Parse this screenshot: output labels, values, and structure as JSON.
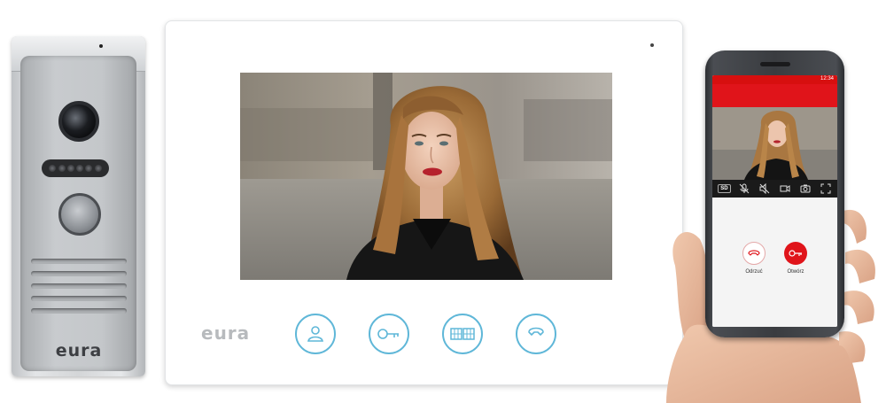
{
  "door_station": {
    "logo": "eura",
    "icons": {
      "camera": "camera-lens-icon",
      "ir_leds": "ir-led-icon",
      "call_button": "call-button-icon",
      "speaker": "speaker-grille-icon"
    },
    "ir_led_count": 6,
    "grille_slots": 5
  },
  "monitor": {
    "logo": "eura",
    "screen_image": "woman-portrait-photo",
    "buttons": [
      {
        "name": "monitor-button",
        "icon": "person-icon"
      },
      {
        "name": "unlock-button",
        "icon": "key-icon"
      },
      {
        "name": "gate-button",
        "icon": "gate-icon"
      },
      {
        "name": "handset-button",
        "icon": "handset-icon"
      }
    ],
    "accent_color": "#5fb7d8"
  },
  "phone": {
    "brand_color": "#e0141a",
    "status_text": "12:34",
    "toolbar": {
      "sd_label": "SD",
      "icons": [
        "mic-muted-icon",
        "speaker-muted-icon",
        "record-icon",
        "snapshot-icon",
        "fullscreen-icon"
      ]
    },
    "decline_label": "Odrzuć",
    "open_label": "Otwórz",
    "icons": {
      "decline": "hang-up-icon",
      "open": "key-icon"
    }
  }
}
